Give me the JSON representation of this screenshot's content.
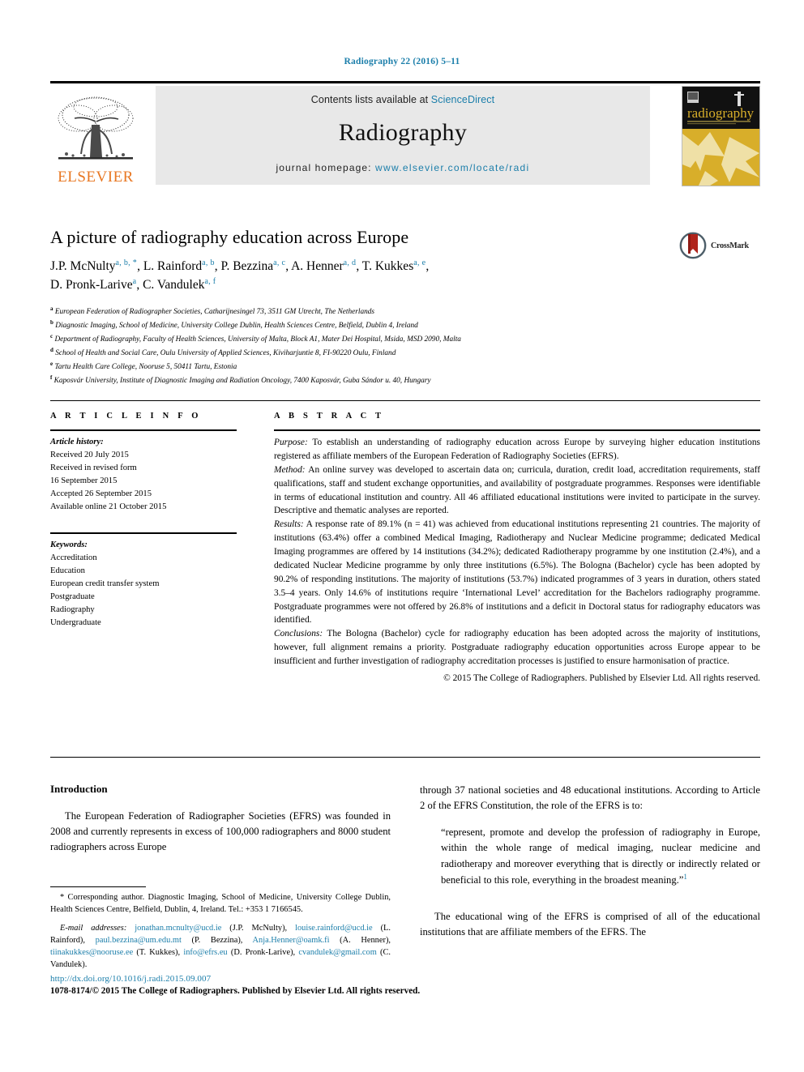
{
  "running_head": "Radiography 22 (2016) 5–11",
  "masthead": {
    "publisher": "ELSEVIER",
    "contents_prefix": "Contents lists available at ",
    "contents_link": "ScienceDirect",
    "journal_name": "Radiography",
    "homepage_prefix": "journal homepage: ",
    "homepage_url": "www.elsevier.com/locate/radi",
    "cover_title": "radiography"
  },
  "article": {
    "title": "A picture of radiography education across Europe",
    "crossmark_label": "CrossMark",
    "authors_line1": "J.P. McNulty",
    "authors": [
      {
        "name": "J.P. McNulty",
        "marks": "a, b, *"
      },
      {
        "name": "L. Rainford",
        "marks": "a, b"
      },
      {
        "name": "P. Bezzina",
        "marks": "a, c"
      },
      {
        "name": "A. Henner",
        "marks": "a, d"
      },
      {
        "name": "T. Kukkes",
        "marks": "a, e"
      },
      {
        "name": "D. Pronk-Larive",
        "marks": "a"
      },
      {
        "name": "C. Vandulek",
        "marks": "a, f"
      }
    ],
    "affiliations": [
      {
        "mark": "a",
        "text": "European Federation of Radiographer Societies, Catharijnesingel 73, 3511 GM Utrecht, The Netherlands"
      },
      {
        "mark": "b",
        "text": "Diagnostic Imaging, School of Medicine, University College Dublin, Health Sciences Centre, Belfield, Dublin 4, Ireland"
      },
      {
        "mark": "c",
        "text": "Department of Radiography, Faculty of Health Sciences, University of Malta, Block A1, Mater Dei Hospital, Msida, MSD 2090, Malta"
      },
      {
        "mark": "d",
        "text": "School of Health and Social Care, Oulu University of Applied Sciences, Kiviharjuntie 8, FI-90220 Oulu, Finland"
      },
      {
        "mark": "e",
        "text": "Tartu Health Care College, Nooruse 5, 50411 Tartu, Estonia"
      },
      {
        "mark": "f",
        "text": "Kaposvár University, Institute of Diagnostic Imaging and Radiation Oncology, 7400 Kaposvár, Guba Sándor u. 40, Hungary"
      }
    ]
  },
  "article_info": {
    "heading": "A R T I C L E  I N F O",
    "history_label": "Article history:",
    "history": [
      "Received 20 July 2015",
      "Received in revised form",
      "16 September 2015",
      "Accepted 26 September 2015",
      "Available online 21 October 2015"
    ],
    "keywords_label": "Keywords:",
    "keywords": [
      "Accreditation",
      "Education",
      "European credit transfer system",
      "Postgraduate",
      "Radiography",
      "Undergraduate"
    ]
  },
  "abstract": {
    "heading": "A B S T R A C T",
    "sections": [
      {
        "label": "Purpose:",
        "text": " To establish an understanding of radiography education across Europe by surveying higher education institutions registered as affiliate members of the European Federation of Radiography Societies (EFRS)."
      },
      {
        "label": "Method:",
        "text": " An online survey was developed to ascertain data on; curricula, duration, credit load, accreditation requirements, staff qualifications, staff and student exchange opportunities, and availability of postgraduate programmes. Responses were identifiable in terms of educational institution and country. All 46 affiliated educational institutions were invited to participate in the survey. Descriptive and thematic analyses are reported."
      },
      {
        "label": "Results:",
        "text": " A response rate of 89.1% (n = 41) was achieved from educational institutions representing 21 countries. The majority of institutions (63.4%) offer a combined Medical Imaging, Radiotherapy and Nuclear Medicine programme; dedicated Medical Imaging programmes are offered by 14 institutions (34.2%); dedicated Radiotherapy programme by one institution (2.4%), and a dedicated Nuclear Medicine programme by only three institutions (6.5%). The Bologna (Bachelor) cycle has been adopted by 90.2% of responding institutions. The majority of institutions (53.7%) indicated programmes of 3 years in duration, others stated 3.5–4 years. Only 14.6% of institutions require ‘International Level’ accreditation for the Bachelors radiography programme. Postgraduate programmes were not offered by 26.8% of institutions and a deficit in Doctoral status for radiography educators was identified."
      },
      {
        "label": "Conclusions:",
        "text": " The Bologna (Bachelor) cycle for radiography education has been adopted across the majority of institutions, however, full alignment remains a priority. Postgraduate radiography education opportunities across Europe appear to be insufficient and further investigation of radiography accreditation processes is justified to ensure harmonisation of practice."
      }
    ],
    "copyright": "© 2015 The College of Radiographers. Published by Elsevier Ltd. All rights reserved."
  },
  "body": {
    "intro_heading": "Introduction",
    "left_paragraph": "The European Federation of Radiographer Societies (EFRS) was founded in 2008 and currently represents in excess of 100,000 radiographers and 8000 student radiographers across Europe",
    "right_paragraph_1": "through 37 national societies and 48 educational institutions. According to Article 2 of the EFRS Constitution, the role of the EFRS is to:",
    "quote": "“represent, promote and develop the profession of radiography in Europe, within the whole range of medical imaging, nuclear medicine and radiotherapy and moreover everything that is directly or indirectly related or beneficial to this role, everything in the broadest meaning.”",
    "quote_ref": "1",
    "right_paragraph_2": "The educational wing of the EFRS is comprised of all of the educational institutions that are affiliate members of the EFRS. The"
  },
  "footnotes": {
    "corresponding": "* Corresponding author. Diagnostic Imaging, School of Medicine, University College Dublin, Health Sciences Centre, Belfield, Dublin, 4, Ireland. Tel.: +353 1 7166545.",
    "email_label": "E-mail addresses:",
    "emails": [
      {
        "address": "jonathan.mcnulty@ucd.ie",
        "owner": " (J.P. McNulty), "
      },
      {
        "address": "louise.rainford@ucd.ie",
        "owner": " (L. Rainford), "
      },
      {
        "address": "paul.bezzina@um.edu.mt",
        "owner": " (P. Bezzina), "
      },
      {
        "address": "Anja.Henner@oamk.fi",
        "owner": " (A. Henner), "
      },
      {
        "address": "tiinakukkes@nooruse.ee",
        "owner": " (T. Kukkes), "
      },
      {
        "address": "info@efrs.eu",
        "owner": " (D. Pronk-Larive), "
      },
      {
        "address": "cvandulek@gmail.com",
        "owner": " (C. Vandulek)."
      }
    ]
  },
  "footer": {
    "doi": "http://dx.doi.org/10.1016/j.radi.2015.09.007",
    "issn_line": "1078-8174/© 2015 The College of Radiographers. Published by Elsevier Ltd. All rights reserved."
  },
  "colors": {
    "link_blue": "#1b7eaa",
    "elsevier_orange": "#e87722",
    "crossmark_red": "#b0241c",
    "cover_gold": "#d8ae2a"
  }
}
